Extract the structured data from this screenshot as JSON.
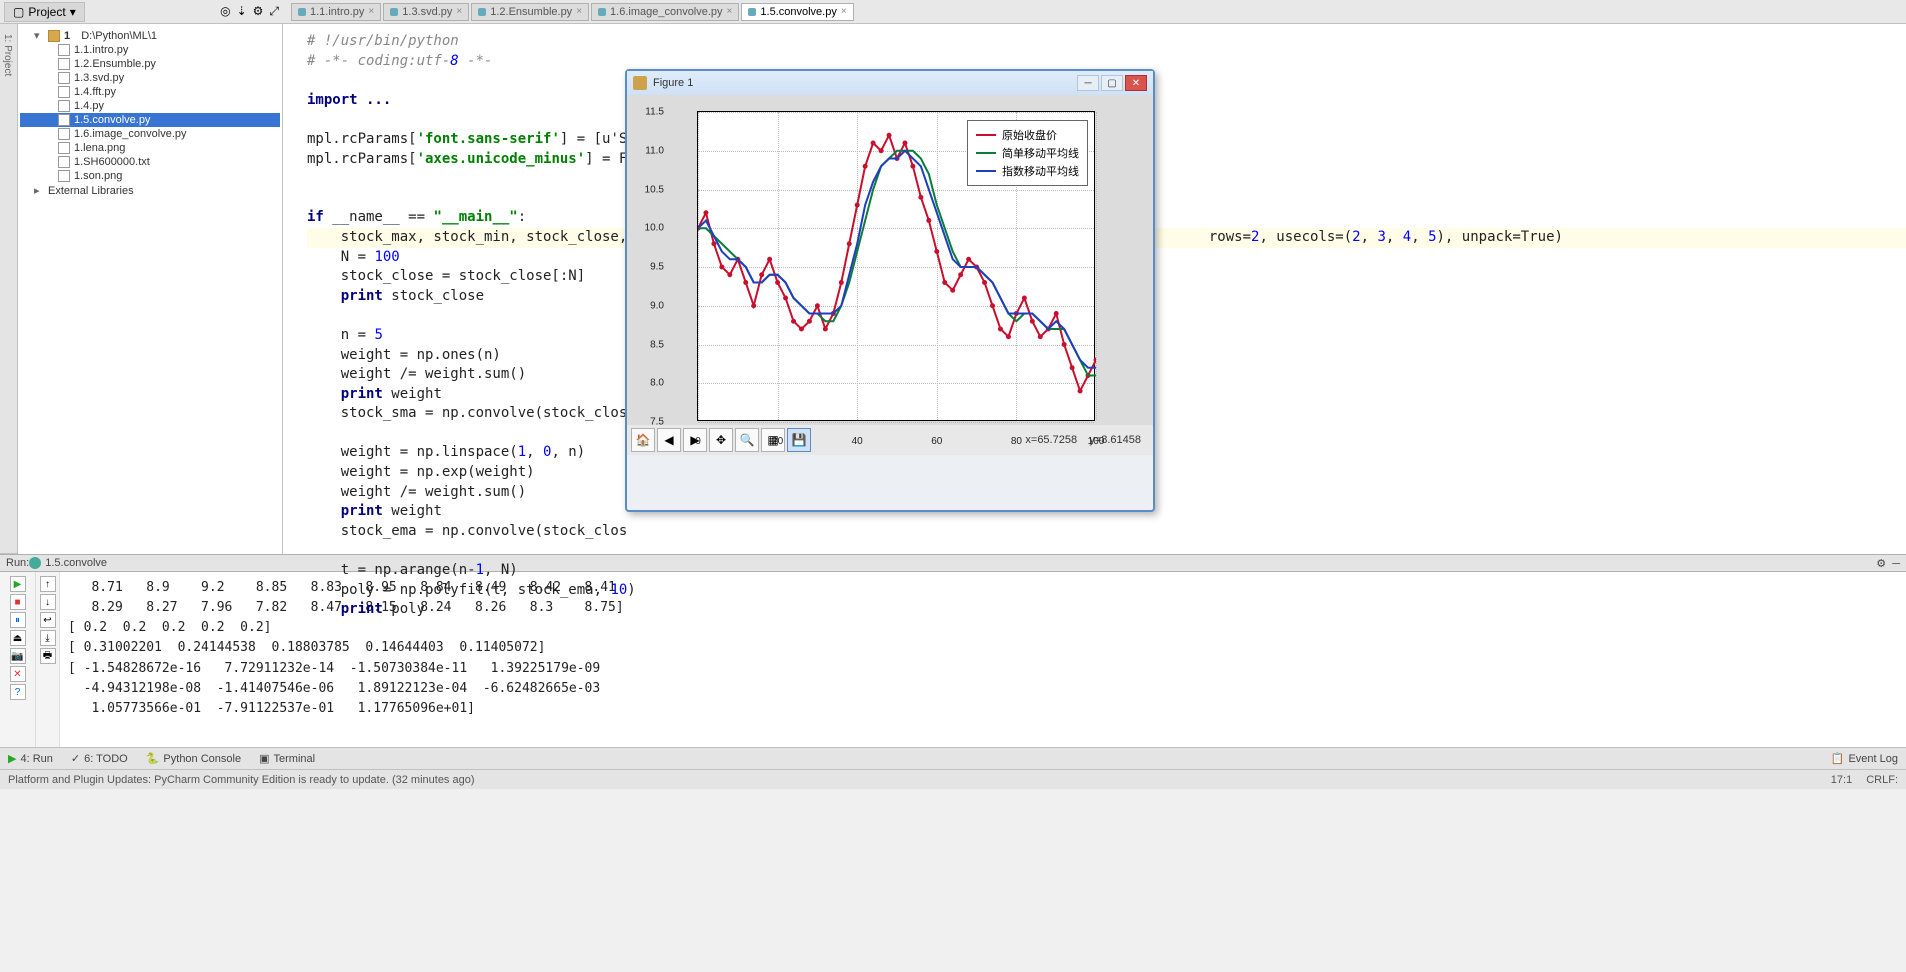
{
  "tabs": {
    "project_label": "Project",
    "open": [
      {
        "label": "1.1.intro.py"
      },
      {
        "label": "1.3.svd.py"
      },
      {
        "label": "1.2.Ensumble.py"
      },
      {
        "label": "1.6.image_convolve.py"
      },
      {
        "label": "1.5.convolve.py",
        "active": true
      }
    ]
  },
  "tree": {
    "root": "D:\\Python\\ML\\1",
    "items": [
      "1.1.intro.py",
      "1.2.Ensumble.py",
      "1.3.svd.py",
      "1.4.fft.py",
      "1.4.py",
      "1.5.convolve.py",
      "1.6.image_convolve.py",
      "1.lena.png",
      "1.SH600000.txt",
      "1.son.png"
    ],
    "selected": "1.5.convolve.py",
    "external": "External Libraries"
  },
  "code": {
    "lines": [
      {
        "t": "# !/usr/bin/python",
        "cls": "c-comment"
      },
      {
        "t": "# -*- coding:utf-8 -*-",
        "cls": "c-comment"
      },
      {
        "t": "",
        "cls": ""
      },
      {
        "t": "import ...",
        "cls": "c-kw"
      },
      {
        "t": "",
        "cls": ""
      },
      {
        "t": "mpl.rcParams['font.sans-serif'] = [u'S",
        "cls": ""
      },
      {
        "t": "mpl.rcParams['axes.unicode_minus'] = F",
        "cls": ""
      },
      {
        "t": "",
        "cls": ""
      },
      {
        "t": "",
        "cls": ""
      },
      {
        "t": "if __name__ == \"__main__\":",
        "cls": ""
      },
      {
        "t": "    stock_max, stock_min, stock_close,                                                                     rows=2, usecols=(2, 3, 4, 5), unpack=True)",
        "cls": "",
        "hl": true
      },
      {
        "t": "    N = 100",
        "cls": ""
      },
      {
        "t": "    stock_close = stock_close[:N]",
        "cls": ""
      },
      {
        "t": "    print stock_close",
        "cls": ""
      },
      {
        "t": "",
        "cls": ""
      },
      {
        "t": "    n = 5",
        "cls": ""
      },
      {
        "t": "    weight = np.ones(n)",
        "cls": ""
      },
      {
        "t": "    weight /= weight.sum()",
        "cls": ""
      },
      {
        "t": "    print weight",
        "cls": ""
      },
      {
        "t": "    stock_sma = np.convolve(stock_clos",
        "cls": ""
      },
      {
        "t": "",
        "cls": ""
      },
      {
        "t": "    weight = np.linspace(1, 0, n)",
        "cls": ""
      },
      {
        "t": "    weight = np.exp(weight)",
        "cls": ""
      },
      {
        "t": "    weight /= weight.sum()",
        "cls": ""
      },
      {
        "t": "    print weight",
        "cls": ""
      },
      {
        "t": "    stock_ema = np.convolve(stock_clos",
        "cls": ""
      },
      {
        "t": "",
        "cls": ""
      },
      {
        "t": "    t = np.arange(n-1, N)",
        "cls": ""
      },
      {
        "t": "    poly = np.polyfit(t, stock_ema, 10)",
        "cls": ""
      },
      {
        "t": "    print poly",
        "cls": ""
      }
    ]
  },
  "figure": {
    "title": "Figure 1",
    "legend": [
      "原始收盘价",
      "简单移动平均线",
      "指数移动平均线"
    ],
    "legend_colors": [
      "#c8102e",
      "#0a7d3a",
      "#1e3fbf"
    ],
    "status_x": "x=65.7258",
    "status_y": "y=8.61458"
  },
  "chart_data": {
    "type": "line",
    "xlabel": "",
    "ylabel": "",
    "xlim": [
      0,
      100
    ],
    "ylim": [
      7.5,
      11.5
    ],
    "x_ticks": [
      0,
      20,
      40,
      60,
      80,
      100
    ],
    "y_ticks": [
      7.5,
      8.0,
      8.5,
      9.0,
      9.5,
      10.0,
      10.5,
      11.0,
      11.5
    ],
    "x": [
      0,
      2,
      4,
      6,
      8,
      10,
      12,
      14,
      16,
      18,
      20,
      22,
      24,
      26,
      28,
      30,
      32,
      34,
      36,
      38,
      40,
      42,
      44,
      46,
      48,
      50,
      52,
      54,
      56,
      58,
      60,
      62,
      64,
      66,
      68,
      70,
      72,
      74,
      76,
      78,
      80,
      82,
      84,
      86,
      88,
      90,
      92,
      94,
      96,
      98,
      100
    ],
    "series": [
      {
        "name": "原始收盘价",
        "color": "#c8102e",
        "marker": true,
        "values": [
          10.0,
          10.2,
          9.8,
          9.5,
          9.4,
          9.6,
          9.3,
          9.0,
          9.4,
          9.6,
          9.3,
          9.1,
          8.8,
          8.7,
          8.8,
          9.0,
          8.7,
          8.9,
          9.3,
          9.8,
          10.3,
          10.8,
          11.1,
          11.0,
          11.2,
          10.9,
          11.1,
          10.8,
          10.4,
          10.1,
          9.7,
          9.3,
          9.2,
          9.4,
          9.6,
          9.5,
          9.3,
          9.0,
          8.7,
          8.6,
          8.9,
          9.1,
          8.8,
          8.6,
          8.7,
          8.9,
          8.5,
          8.2,
          7.9,
          8.1,
          8.3
        ]
      },
      {
        "name": "简单移动平均线",
        "color": "#0a7d3a",
        "marker": false,
        "values": [
          10.0,
          10.0,
          9.9,
          9.8,
          9.7,
          9.6,
          9.5,
          9.3,
          9.3,
          9.4,
          9.4,
          9.3,
          9.1,
          9.0,
          8.9,
          8.9,
          8.8,
          8.8,
          9.0,
          9.3,
          9.7,
          10.1,
          10.5,
          10.8,
          10.9,
          11.0,
          11.0,
          11.0,
          10.9,
          10.7,
          10.3,
          10.0,
          9.7,
          9.5,
          9.5,
          9.5,
          9.4,
          9.3,
          9.1,
          8.9,
          8.8,
          8.9,
          8.9,
          8.8,
          8.7,
          8.7,
          8.7,
          8.5,
          8.3,
          8.1,
          8.1
        ]
      },
      {
        "name": "指数移动平均线",
        "color": "#1e3fbf",
        "marker": false,
        "values": [
          10.0,
          10.1,
          9.9,
          9.7,
          9.6,
          9.6,
          9.5,
          9.3,
          9.3,
          9.4,
          9.4,
          9.3,
          9.1,
          9.0,
          8.9,
          8.9,
          8.9,
          8.9,
          9.0,
          9.4,
          9.8,
          10.3,
          10.6,
          10.8,
          10.9,
          10.9,
          11.0,
          10.9,
          10.8,
          10.5,
          10.2,
          9.9,
          9.6,
          9.5,
          9.5,
          9.5,
          9.4,
          9.3,
          9.1,
          8.9,
          8.9,
          8.9,
          8.9,
          8.8,
          8.7,
          8.8,
          8.7,
          8.5,
          8.3,
          8.2,
          8.2
        ]
      }
    ]
  },
  "run": {
    "label": "Run:",
    "config": "1.5.convolve"
  },
  "console": {
    "lines": [
      "   8.71   8.9    9.2    8.85   8.83   8.95   8.84   8.49   8.42   8.41",
      "   8.29   8.27   7.96   7.82   8.47   8.15   8.24   8.26   8.3    8.75]",
      "[ 0.2  0.2  0.2  0.2  0.2]",
      "[ 0.31002201  0.24144538  0.18803785  0.14644403  0.11405072]",
      "[ -1.54828672e-16   7.72911232e-14  -1.50730384e-11   1.39225179e-09",
      "  -4.94312198e-08  -1.41407546e-06   1.89122123e-04  -6.62482665e-03",
      "   1.05773566e-01  -7.91122537e-01   1.17765096e+01]"
    ]
  },
  "bottom": {
    "run": "4: Run",
    "todo": "6: TODO",
    "pyconsole": "Python Console",
    "terminal": "Terminal",
    "eventlog": "Event Log"
  },
  "status": {
    "msg": "Platform and Plugin Updates: PyCharm Community Edition is ready to update. (32 minutes ago)",
    "pos": "17:1",
    "enc": "CRLF:"
  }
}
